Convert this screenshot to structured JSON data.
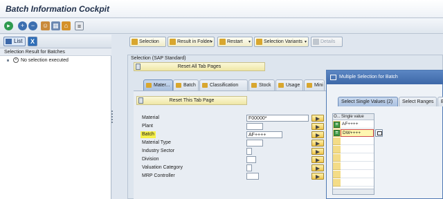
{
  "window": {
    "title": "Batch Information Cockpit"
  },
  "toolbar": {
    "icons": [
      "execute-icon",
      "zoom-in-icon",
      "zoom-out-icon",
      "people-icon",
      "picture-icon",
      "house-icon",
      "list-icon"
    ]
  },
  "left_pane": {
    "list_label": "List",
    "tree_header": "Selection Result for Batches",
    "tree_node": "No selection executed"
  },
  "right_buttons": {
    "selection": "Selection",
    "result_in_folder": "Result in Folder",
    "restart": "Restart",
    "selection_variants": "Selection Variants",
    "details": "Details"
  },
  "selection_group": {
    "label": "Selection (SAP Standard)",
    "reset_all": "Reset All Tab Pages",
    "tabs": [
      "Mater...",
      "Batch",
      "Classification",
      "Stock",
      "Usage",
      "Mini"
    ],
    "reset_this": "Reset This Tab Page",
    "fields": [
      {
        "label": "Material",
        "value": "F00000*"
      },
      {
        "label": "Plant",
        "value": ""
      },
      {
        "label": "Batch",
        "value": "AF++++"
      },
      {
        "label": "Material Type",
        "value": ""
      },
      {
        "label": "Industry Sector",
        "value": ""
      },
      {
        "label": "Division",
        "value": ""
      },
      {
        "label": "Valuation Category",
        "value": ""
      },
      {
        "label": "MRP Controller",
        "value": ""
      }
    ]
  },
  "dialog": {
    "title": "Multiple Selection for Batch",
    "tabs": [
      "Select Single Values (2)",
      "Select Ranges",
      "E"
    ],
    "grid_header_op": "O...",
    "grid_header_value": "Single value",
    "rows": [
      "AF++++",
      "DW++++"
    ]
  }
}
